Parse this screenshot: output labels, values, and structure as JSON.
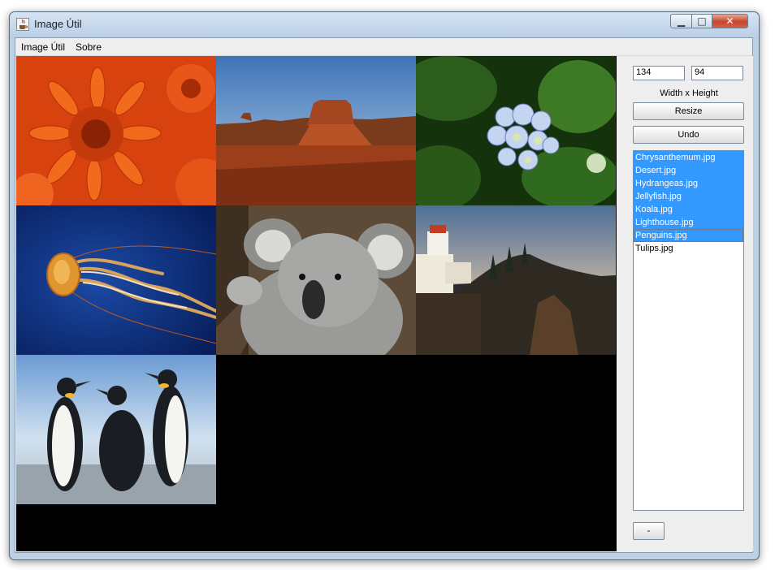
{
  "window": {
    "title": "Image Útil",
    "buttons": {
      "minimize": "▁",
      "maximize": "□",
      "close": "✕"
    }
  },
  "menu": {
    "items": [
      "Image Útil",
      "Sobre"
    ]
  },
  "images": [
    {
      "name": "chrysanthemum",
      "icon": "chrysanthemum-photo"
    },
    {
      "name": "desert",
      "icon": "desert-photo"
    },
    {
      "name": "hydrangeas",
      "icon": "hydrangeas-photo"
    },
    {
      "name": "jellyfish",
      "icon": "jellyfish-photo"
    },
    {
      "name": "koala",
      "icon": "koala-photo"
    },
    {
      "name": "lighthouse",
      "icon": "lighthouse-photo"
    },
    {
      "name": "penguins",
      "icon": "penguins-photo"
    }
  ],
  "controls": {
    "width_value": "134",
    "height_value": "94",
    "size_label": "Width x Height",
    "resize_label": "Resize",
    "undo_label": "Undo",
    "remove_label": "-"
  },
  "file_list": {
    "items": [
      "Chrysanthemum.jpg",
      "Desert.jpg",
      "Hydrangeas.jpg",
      "Jellyfish.jpg",
      "Koala.jpg",
      "Lighthouse.jpg",
      "Penguins.jpg",
      "Tulips.jpg"
    ],
    "selected_count": 7
  },
  "colors": {
    "selection": "#3399ff",
    "canvas_background": "#000000"
  }
}
